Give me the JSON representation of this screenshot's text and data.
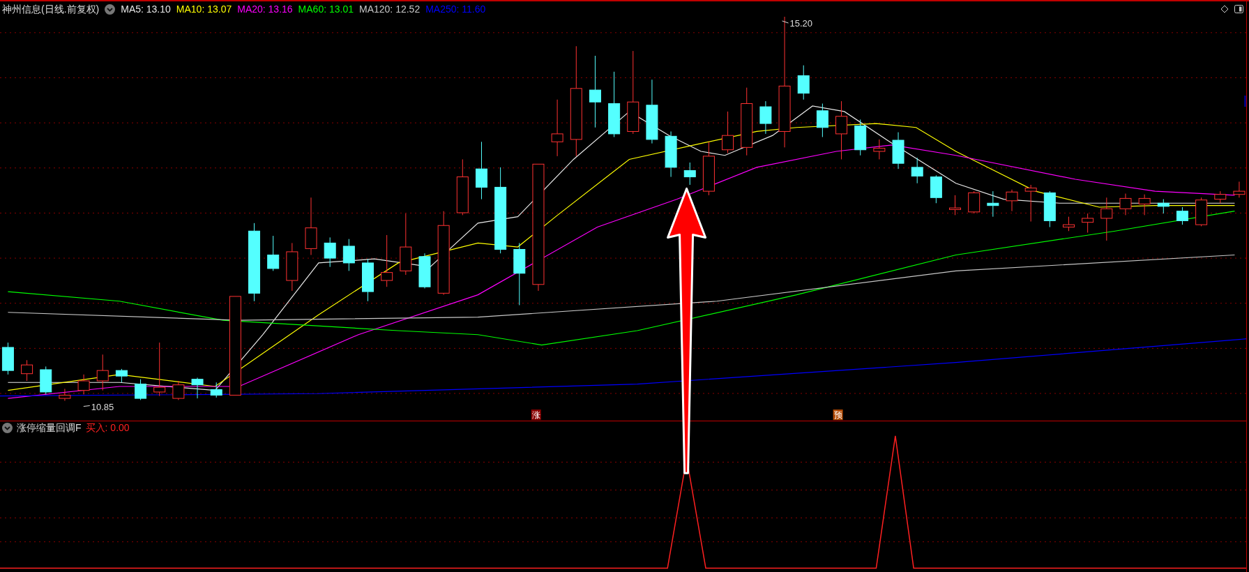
{
  "header": {
    "title": "神州信息(日线.前复权)",
    "indicators": [
      {
        "label": "MA5: 13.10",
        "color": "#e8e8e8"
      },
      {
        "label": "MA10: 13.07",
        "color": "#ffff00"
      },
      {
        "label": "MA20: 13.16",
        "color": "#ff00ff"
      },
      {
        "label": "MA60: 13.01",
        "color": "#00ff00"
      },
      {
        "label": "MA120: 12.52",
        "color": "#c8c8c8"
      },
      {
        "label": "MA250: 11.60",
        "color": "#0000ff"
      }
    ]
  },
  "chart": {
    "high_label": "15.20",
    "low_label": "10.85",
    "markers": [
      {
        "text": "涨",
        "color": "#8b0000"
      },
      {
        "text": "预",
        "color": "#b34a00"
      }
    ]
  },
  "indicator_panel": {
    "title": "涨停缩量回调F",
    "reading": "买入: 0.00"
  }
}
